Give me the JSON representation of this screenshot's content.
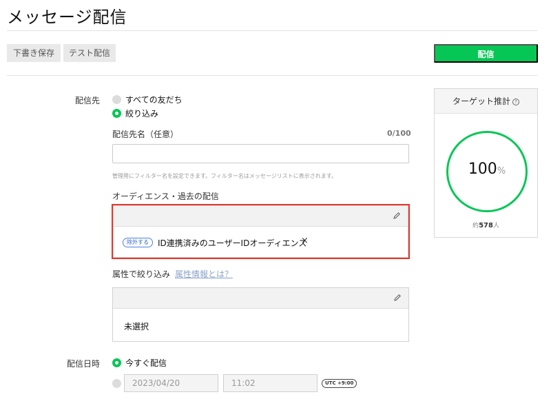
{
  "page": {
    "title": "メッセージ配信"
  },
  "toolbar": {
    "save_draft": "下書き保存",
    "test_send": "テスト配信",
    "send": "配信"
  },
  "recipients": {
    "label": "配信先",
    "option_all": "すべての友だち",
    "option_filter": "絞り込み",
    "selected": "絞り込み"
  },
  "recipient_name": {
    "label": "配信先名（任意）",
    "counter": "0/100",
    "value": "",
    "helper": "管理用にフィルター名を設定できます。フィルター名はメッセージリストに表示されます。"
  },
  "audience": {
    "label": "オーディエンス・過去の配信",
    "pill": "除外する",
    "item": "ID連携済みのユーザーIDオーディエンス",
    "remove": "×"
  },
  "attributes": {
    "label": "属性で絞り込み",
    "link": "属性情報とは？",
    "value": "未選択"
  },
  "schedule": {
    "label": "配信日時",
    "option_now": "今すぐ配信",
    "date": "2023/04/20",
    "time": "11:02",
    "timezone": "UTC +9:00"
  },
  "target": {
    "title": "ターゲット推計",
    "help": "?",
    "percent": "100",
    "percent_symbol": "%",
    "approx_prefix": "約",
    "approx_count": "578",
    "approx_suffix": "人"
  },
  "colors": {
    "accent_green": "#06c755",
    "highlight_red": "#e8352a",
    "link_blue": "#8aa2c8"
  },
  "icons": {
    "edit": "pencil-icon",
    "help": "help-icon",
    "remove": "close-icon"
  }
}
